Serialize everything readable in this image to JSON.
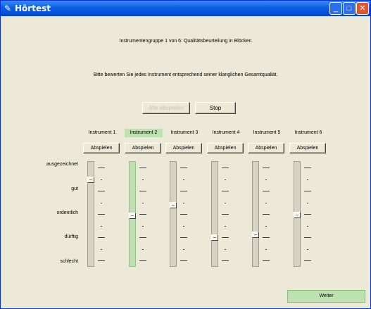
{
  "window": {
    "title": "Hörtest"
  },
  "header": {
    "line1": "Instrumentengruppe 1 von 6: Qualitätsbeurteilung in Blöcken",
    "line2": "Bitte bewerten Sie jedes Instrument entsprechend seiner  klanglichen Gesamtqualiät."
  },
  "controls": {
    "start_label": "Alle abspielen",
    "stop_label": "Stop"
  },
  "scale": [
    "ausgezeichnet",
    "gut",
    "ordentlich",
    "dürftig",
    "schlecht"
  ],
  "instruments": [
    {
      "label": "Instrument 1",
      "play_label": "Abspielen",
      "active": false,
      "rating": 0.85
    },
    {
      "label": "Instrument 2",
      "play_label": "Abspielen",
      "active": true,
      "rating": 0.48
    },
    {
      "label": "Instrument 3",
      "play_label": "Abspielen",
      "active": false,
      "rating": 0.59
    },
    {
      "label": "Instrument 4",
      "play_label": "Abspielen",
      "active": false,
      "rating": 0.26
    },
    {
      "label": "Instrument 5",
      "play_label": "Abspielen",
      "active": false,
      "rating": 0.29
    },
    {
      "label": "Instrument 6",
      "play_label": "Abspielen",
      "active": false,
      "rating": 0.49
    }
  ],
  "footer": {
    "next_label": "Weiter"
  },
  "colors": {
    "active_green": "#bde2b0",
    "titlebar_blue": "#0a5fe0"
  }
}
